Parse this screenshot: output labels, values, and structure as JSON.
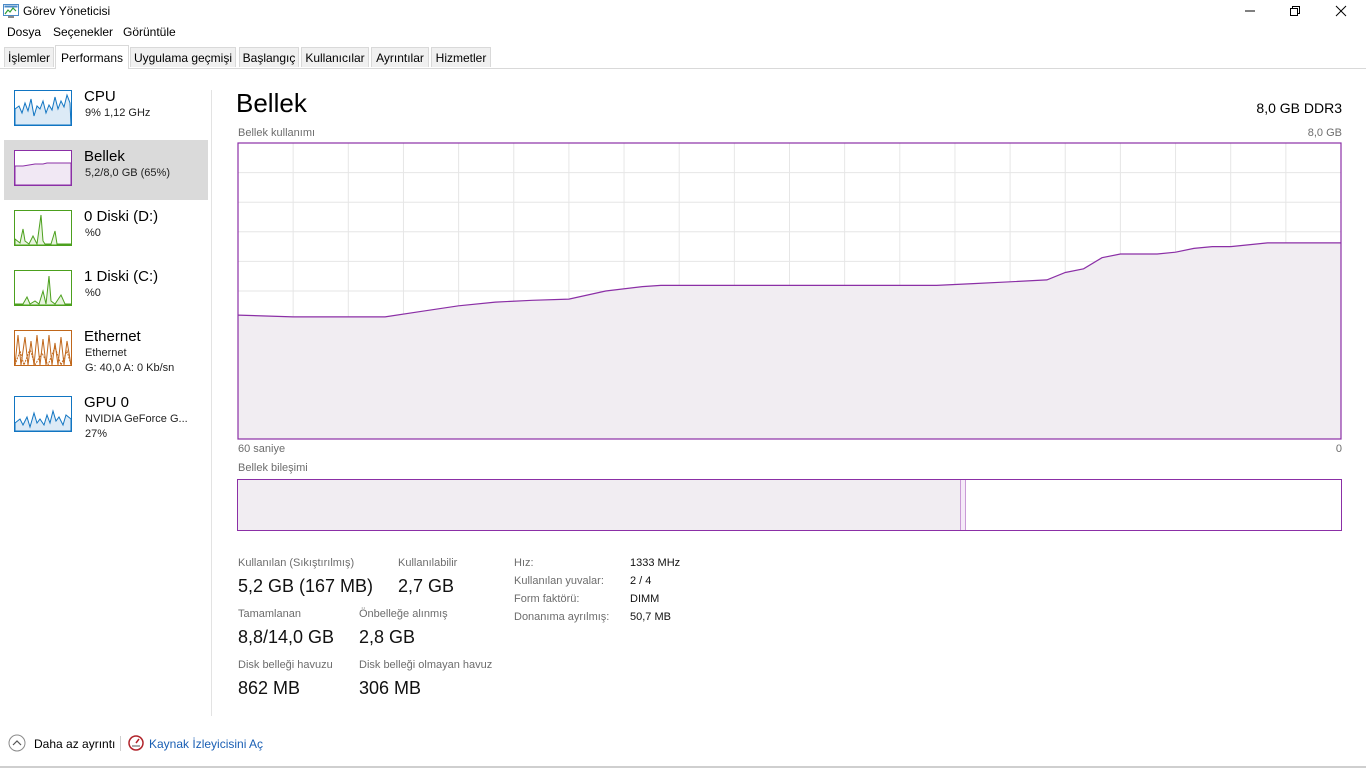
{
  "window": {
    "title": "Görev Yöneticisi",
    "controls": [
      "minimize",
      "maximize",
      "close"
    ]
  },
  "menu": [
    "Dosya",
    "Seçenekler",
    "Görüntüle"
  ],
  "tabs": [
    {
      "label": "İşlemler",
      "active": false
    },
    {
      "label": "Performans",
      "active": true
    },
    {
      "label": "Uygulama geçmişi",
      "active": false
    },
    {
      "label": "Başlangıç",
      "active": false
    },
    {
      "label": "Kullanıcılar",
      "active": false
    },
    {
      "label": "Ayrıntılar",
      "active": false
    },
    {
      "label": "Hizmetler",
      "active": false
    }
  ],
  "sidebar": {
    "items": [
      {
        "name": "CPU",
        "sub1": "9%  1,12 GHz",
        "sub2": "",
        "color": "#1175c2",
        "selected": false
      },
      {
        "name": "Bellek",
        "sub1": "5,2/8,0 GB (65%)",
        "sub2": "",
        "color": "#8b2fa6",
        "selected": true
      },
      {
        "name": "0 Diski (D:)",
        "sub1": "%0",
        "sub2": "",
        "color": "#4ca01e",
        "selected": false
      },
      {
        "name": "1 Diski (C:)",
        "sub1": "%0",
        "sub2": "",
        "color": "#4ca01e",
        "selected": false
      },
      {
        "name": "Ethernet",
        "sub1": "Ethernet",
        "sub2": "G: 40,0  A: 0 Kb/sn",
        "color": "#c0671b",
        "selected": false
      },
      {
        "name": "GPU 0",
        "sub1": "NVIDIA GeForce G...",
        "sub2": "27%",
        "color": "#1175c2",
        "selected": false
      }
    ]
  },
  "main": {
    "title": "Bellek",
    "spec": "8,0 GB DDR3",
    "usage_label": "Bellek kullanımı",
    "usage_max": "8,0 GB",
    "time_left": "60 saniye",
    "time_right": "0",
    "composition_label": "Bellek bileşimi",
    "composition": {
      "in_use_fraction": 0.655,
      "modified_fraction": 0.005
    }
  },
  "chart_data": {
    "type": "area",
    "title": "",
    "xlabel": "",
    "ylabel": "",
    "xlim": [
      60,
      0
    ],
    "ylim": [
      0,
      8.0
    ],
    "grid": true,
    "color": "#8b2fa6",
    "x": [
      60,
      57,
      52,
      50,
      48,
      46,
      44,
      42,
      40,
      38,
      37,
      35,
      32,
      30,
      27,
      24,
      22,
      20,
      18,
      16,
      15,
      14,
      13,
      12,
      11,
      10,
      9,
      8,
      7,
      6,
      4,
      0
    ],
    "values": [
      3.35,
      3.3,
      3.3,
      3.45,
      3.6,
      3.7,
      3.75,
      3.78,
      4.0,
      4.12,
      4.15,
      4.15,
      4.15,
      4.15,
      4.15,
      4.15,
      4.15,
      4.2,
      4.25,
      4.3,
      4.5,
      4.6,
      4.9,
      5.0,
      5.0,
      5.0,
      5.05,
      5.15,
      5.2,
      5.2,
      5.3,
      5.3
    ]
  },
  "stats": {
    "in_use_label": "Kullanılan (Sıkıştırılmış)",
    "in_use_value": "5,2 GB (167 MB)",
    "available_label": "Kullanılabilir",
    "available_value": "2,7 GB",
    "committed_label": "Tamamlanan",
    "committed_value": "8,8/14,0 GB",
    "cached_label": "Önbelleğe alınmış",
    "cached_value": "2,8 GB",
    "paged_label": "Disk belleği havuzu",
    "paged_value": "862 MB",
    "nonpaged_label": "Disk belleği olmayan havuz",
    "nonpaged_value": "306 MB"
  },
  "info": [
    {
      "key": "Hız:",
      "value": "1333 MHz"
    },
    {
      "key": "Kullanılan yuvalar:",
      "value": "2 / 4"
    },
    {
      "key": "Form faktörü:",
      "value": "DIMM"
    },
    {
      "key": "Donanıma ayrılmış:",
      "value": "50,7 MB"
    }
  ],
  "footer": {
    "fewer_details": "Daha az ayrıntı",
    "resource_monitor": "Kaynak İzleyicisini Aç"
  }
}
